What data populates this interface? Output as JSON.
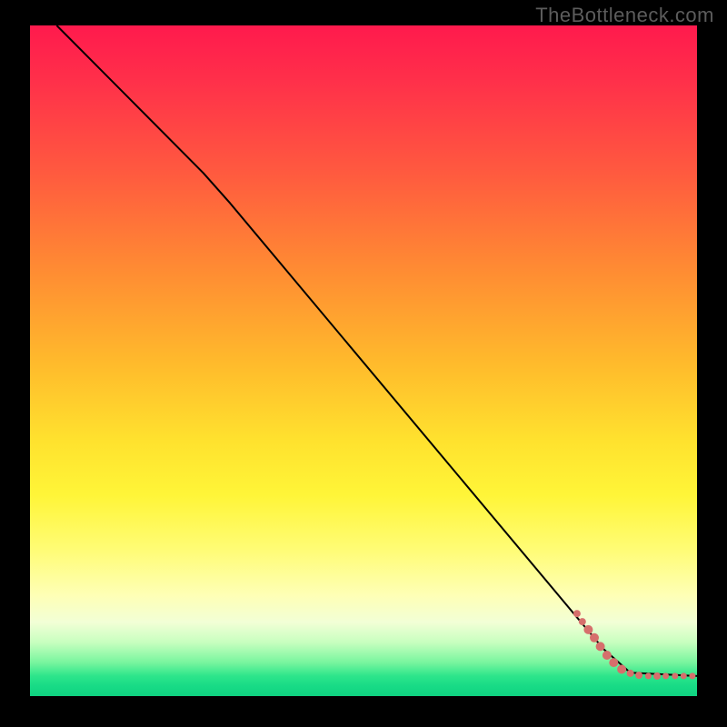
{
  "watermark": "TheBottleneck.com",
  "chart_data": {
    "type": "line",
    "title": "",
    "xlabel": "",
    "ylabel": "",
    "xlim": [
      0,
      100
    ],
    "ylim": [
      0,
      100
    ],
    "series": [
      {
        "name": "curve",
        "style": "solid-black",
        "points": [
          {
            "x": 4,
            "y": 100
          },
          {
            "x": 26,
            "y": 78
          },
          {
            "x": 30,
            "y": 73.5
          },
          {
            "x": 86,
            "y": 7
          },
          {
            "x": 90,
            "y": 3.5
          },
          {
            "x": 100,
            "y": 3
          }
        ]
      },
      {
        "name": "dots",
        "style": "salmon-dots",
        "points": [
          {
            "x": 82,
            "y": 12.3,
            "r": 4
          },
          {
            "x": 82.8,
            "y": 11.1,
            "r": 4
          },
          {
            "x": 83.7,
            "y": 9.9,
            "r": 5
          },
          {
            "x": 84.6,
            "y": 8.7,
            "r": 5
          },
          {
            "x": 85.5,
            "y": 7.4,
            "r": 5
          },
          {
            "x": 86.5,
            "y": 6.1,
            "r": 5
          },
          {
            "x": 87.5,
            "y": 5.0,
            "r": 5
          },
          {
            "x": 88.7,
            "y": 4.0,
            "r": 5
          },
          {
            "x": 90.0,
            "y": 3.4,
            "r": 4
          },
          {
            "x": 91.3,
            "y": 3.1,
            "r": 4
          },
          {
            "x": 92.7,
            "y": 3.0,
            "r": 3.5
          },
          {
            "x": 94.0,
            "y": 3.0,
            "r": 4
          },
          {
            "x": 95.3,
            "y": 3.0,
            "r": 3.5
          },
          {
            "x": 96.7,
            "y": 3.0,
            "r": 3.5
          },
          {
            "x": 98.0,
            "y": 3.0,
            "r": 3.5
          },
          {
            "x": 99.3,
            "y": 3.0,
            "r": 3.5
          }
        ]
      }
    ],
    "colors": {
      "curve": "#000000",
      "dots": "#d66f6c"
    }
  }
}
